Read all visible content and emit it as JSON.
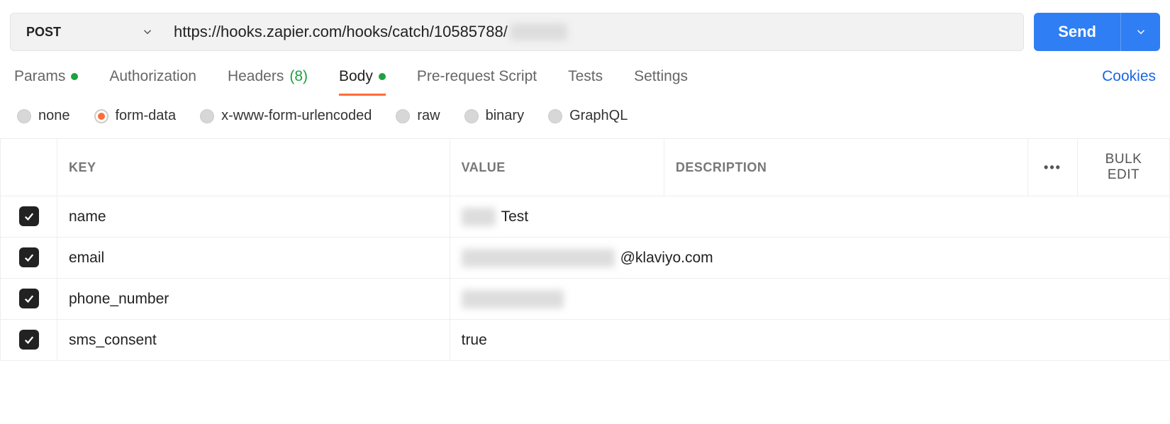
{
  "request": {
    "method": "POST",
    "url_visible": "https://hooks.zapier.com/hooks/catch/10585788/",
    "url_hidden": "xxxxxx",
    "send_label": "Send"
  },
  "tabs": {
    "params": "Params",
    "authorization": "Authorization",
    "headers": "Headers",
    "headers_count": "(8)",
    "body": "Body",
    "prerequest": "Pre-request Script",
    "tests": "Tests",
    "settings": "Settings",
    "cookies": "Cookies"
  },
  "body_types": {
    "none": "none",
    "formdata": "form-data",
    "urlencoded": "x-www-form-urlencoded",
    "raw": "raw",
    "binary": "binary",
    "graphql": "GraphQL"
  },
  "table": {
    "headers": {
      "key": "KEY",
      "value": "VALUE",
      "description": "DESCRIPTION"
    },
    "more_icon": "•••",
    "bulk_edit": "Bulk Edit",
    "rows": [
      {
        "key": "name",
        "value_hidden": "XXXX",
        "value_suffix": " Test"
      },
      {
        "key": "email",
        "value_hidden": "xxxxxxxxxxxxxxxxxx",
        "value_suffix": "@klaviyo.com"
      },
      {
        "key": "phone_number",
        "value_hidden": "xxxxxxxxxxxx",
        "value_suffix": ""
      },
      {
        "key": "sms_consent",
        "value_hidden": "",
        "value_suffix": "true"
      }
    ]
  }
}
